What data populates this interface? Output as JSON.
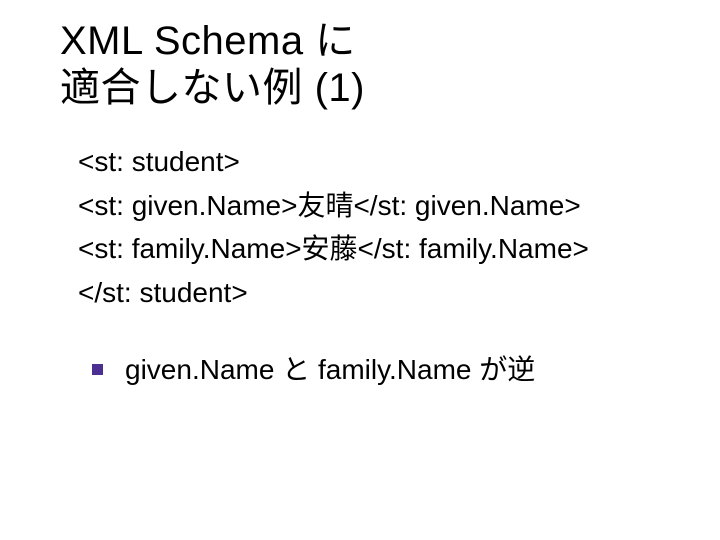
{
  "title_line1": "XML Schema に",
  "title_line2": "適合しない例 (1)",
  "xml": {
    "l1": "<st: student>",
    "l2": "<st: given.Name>友晴</st: given.Name>",
    "l3": "<st: family.Name>安藤</st: family.Name>",
    "l4": "</st: student>"
  },
  "note": "given.Name と family.Name が逆"
}
